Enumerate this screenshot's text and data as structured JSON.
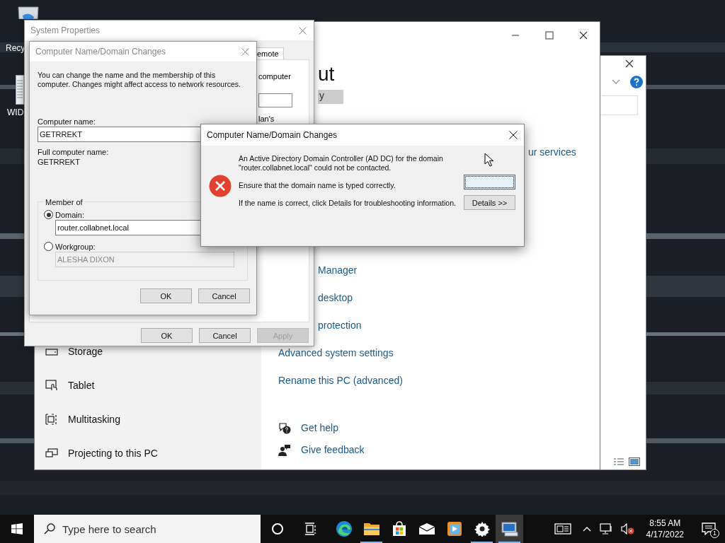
{
  "desktop": {
    "icons": [
      {
        "kind": "recycle",
        "label": "Recy"
      },
      {
        "kind": "document",
        "label": "WID"
      }
    ]
  },
  "settings_window": {
    "heading": "ut",
    "highlight": "y",
    "services_link": "ur services",
    "sidebar": [
      {
        "kind": "storage",
        "label": "Storage"
      },
      {
        "kind": "tablet",
        "label": "Tablet"
      },
      {
        "kind": "multitasking",
        "label": "Multitasking"
      },
      {
        "kind": "projecting",
        "label": "Projecting to this PC"
      }
    ],
    "related_links": [
      "Manager",
      "desktop",
      "protection"
    ],
    "links": [
      "Advanced system settings",
      "Rename this PC (advanced)"
    ],
    "help": [
      {
        "kind": "help",
        "label": "Get help"
      },
      {
        "kind": "feedback",
        "label": "Give feedback"
      }
    ]
  },
  "system_properties": {
    "title": "System Properties",
    "tab": "emote",
    "fragments": [
      "computer",
      "lan's"
    ],
    "buttons": [
      {
        "label": "OK",
        "disabled": false
      },
      {
        "label": "Cancel",
        "disabled": false
      },
      {
        "label": "Apply",
        "disabled": true
      }
    ]
  },
  "name_dialog": {
    "title": "Computer Name/Domain Changes",
    "intro": "You can change the name and the membership of this computer. Changes might affect access to network resources.",
    "computer_name_label": "Computer name:",
    "computer_name": "GETRREKT",
    "full_name_label": "Full computer name:",
    "full_name": "GETRREKT",
    "member_of": "Member of",
    "options": [
      {
        "label": "Domain:",
        "selected": true,
        "value": "router.collabnet.local"
      },
      {
        "label": "Workgroup:",
        "selected": false,
        "value": "ALESHA DIXON"
      }
    ],
    "buttons": [
      "OK",
      "Cancel"
    ]
  },
  "error_dialog": {
    "title": "Computer Name/Domain Changes",
    "messages": [
      "An Active Directory Domain Controller (AD DC) for the domain \"router.collabnet.local\" could not be contacted.",
      "Ensure that the domain name is typed correctly.",
      "If the name is correct, click Details for troubleshooting information."
    ],
    "buttons": [
      {
        "focused": true
      },
      {
        "label": "Details >>",
        "focused": false
      }
    ]
  },
  "taskbar": {
    "search_placeholder": "Type here to search",
    "apps": [
      {
        "kind": "cortana",
        "running": false,
        "active": false
      },
      {
        "kind": "taskview",
        "running": false,
        "active": false
      },
      {
        "kind": "edge",
        "running": false,
        "active": false
      },
      {
        "kind": "explorer",
        "running": true,
        "active": false
      },
      {
        "kind": "store",
        "running": false,
        "active": false
      },
      {
        "kind": "mail",
        "running": false,
        "active": false
      },
      {
        "kind": "media",
        "running": false,
        "active": false
      },
      {
        "kind": "settings",
        "running": true,
        "active": false
      },
      {
        "kind": "sysprops",
        "running": true,
        "active": true
      }
    ],
    "muted": true,
    "time": "8:55 AM",
    "date": "4/17/2022",
    "notifications": "1"
  }
}
